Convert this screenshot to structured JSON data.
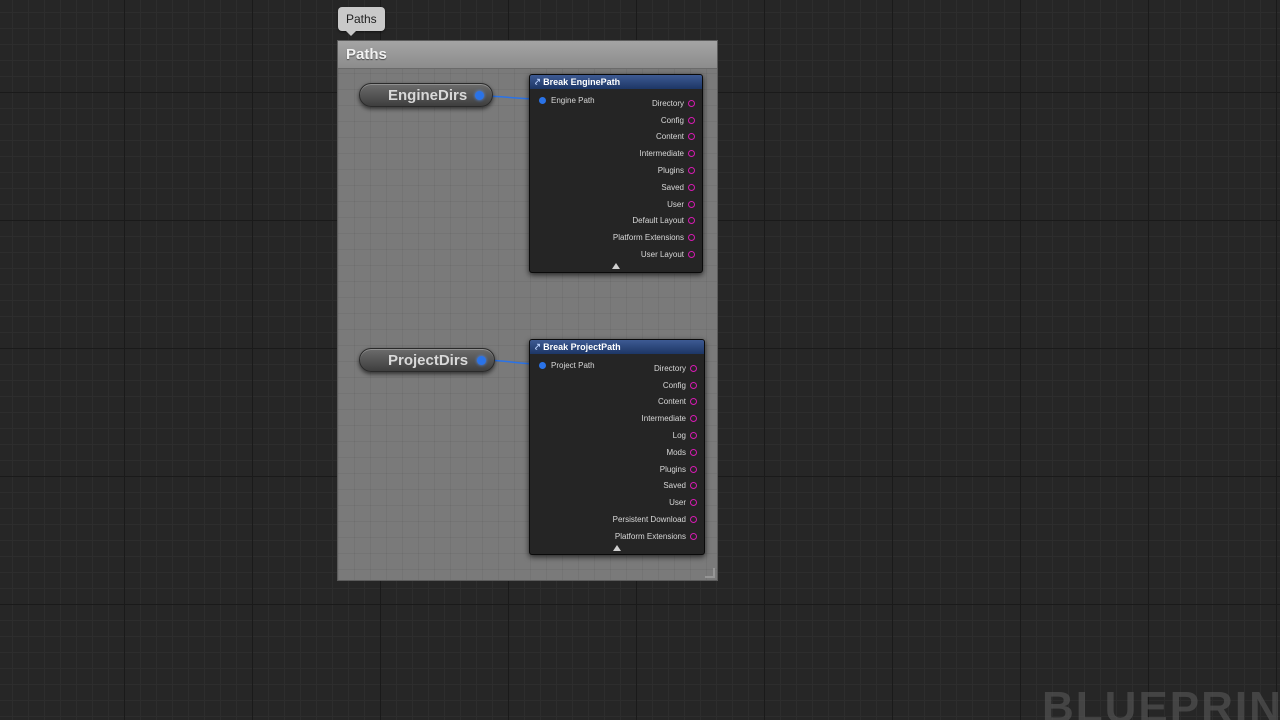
{
  "comment_bubble": "Paths",
  "comment_title": "Paths",
  "engine": {
    "variable": "EngineDirs",
    "node_title": "Break EnginePath",
    "input_pin": "Engine Path",
    "outputs": [
      "Directory",
      "Config",
      "Content",
      "Intermediate",
      "Plugins",
      "Saved",
      "User",
      "Default Layout",
      "Platform Extensions",
      "User Layout"
    ]
  },
  "project": {
    "variable": "ProjectDirs",
    "node_title": "Break ProjectPath",
    "input_pin": "Project Path",
    "outputs": [
      "Directory",
      "Config",
      "Content",
      "Intermediate",
      "Log",
      "Mods",
      "Plugins",
      "Saved",
      "User",
      "Persistent Download",
      "Platform Extensions"
    ]
  },
  "watermark": "BLUEPRINT",
  "colors": {
    "struct_pin": "#2a73e8",
    "string_pin": "#d61ab2",
    "node_header": "#2a4a85"
  }
}
